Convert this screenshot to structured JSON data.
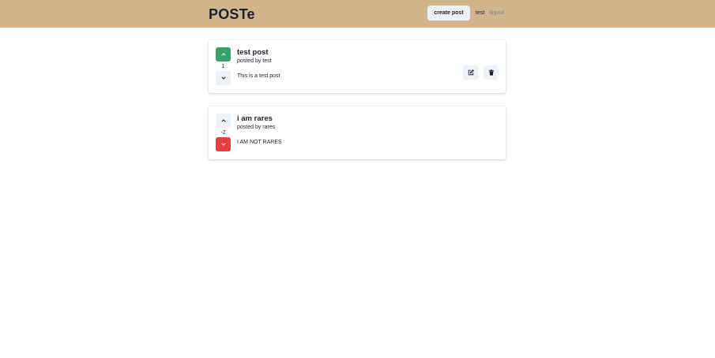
{
  "header": {
    "logo": "POSTe",
    "create_label": "create post",
    "username": "test",
    "logout_label": "logout",
    "background": "#d3b58d"
  },
  "posts": [
    {
      "title": "test post",
      "author_line": "posted by test",
      "body": "This is a test post",
      "score": "1",
      "vote": "up",
      "actions": [
        "edit-icon",
        "trash-icon"
      ]
    },
    {
      "title": "i am rares",
      "author_line": "posted by rares",
      "body": "I AM NOT RARES",
      "score": "-2",
      "vote": "down",
      "actions": []
    }
  ],
  "colors": {
    "upvote_active": "#38a169",
    "downvote_active": "#e53e3e",
    "neutral_button": "#edf2f7"
  }
}
